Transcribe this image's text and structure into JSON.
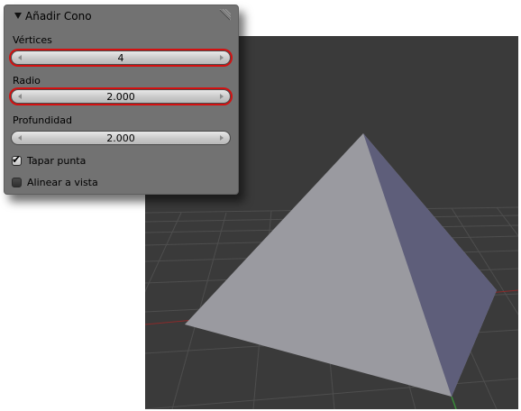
{
  "panel": {
    "title": "Añadir Cono",
    "collapse_icon": "triangle-down-icon",
    "drag_icon": "drag-corner-icon",
    "fields": [
      {
        "label": "Vértices",
        "value": "4",
        "highlighted": true
      },
      {
        "label": "Radio",
        "value": "2.000",
        "highlighted": true
      },
      {
        "label": "Profundidad",
        "value": "2.000",
        "highlighted": false
      }
    ],
    "checkboxes": [
      {
        "label": "Tapar punta",
        "checked": true
      },
      {
        "label": "Alinear a vista",
        "checked": false
      }
    ]
  },
  "viewport": {
    "background": "#3a3a3a",
    "grid_color": "#4e4e4e",
    "x_axis_color": "#8a2a2a",
    "y_axis_color": "#3a8a3a",
    "pyramid_left_face": "#9a9aa0",
    "pyramid_right_face": "#5e5e7a"
  },
  "highlight_color": "#d41010"
}
